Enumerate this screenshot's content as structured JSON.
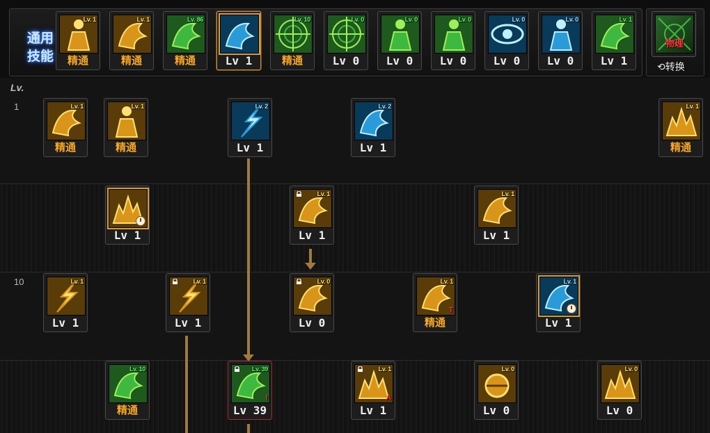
{
  "common_skills": {
    "title_line1": "通用",
    "title_line2": "技能",
    "items": [
      {
        "badge": "Lv. 1",
        "label": "精通",
        "mastery": true,
        "icon": "seated-figure-icon",
        "badge_color": "y"
      },
      {
        "badge": "Lv. 1",
        "label": "精通",
        "mastery": true,
        "icon": "arm-strength-icon",
        "badge_color": "y"
      },
      {
        "badge": "Lv. 86",
        "label": "精通",
        "mastery": true,
        "icon": "leg-kick-icon",
        "badge_color": "g"
      },
      {
        "badge": "",
        "label": "Lv 1",
        "mastery": false,
        "icon": "wings-burst-icon",
        "badge_color": "b"
      },
      {
        "badge": "Lv. 10",
        "label": "精通",
        "mastery": true,
        "icon": "crosshair-icon",
        "badge_color": "g"
      },
      {
        "badge": "Lv. 0",
        "label": "Lv 0",
        "mastery": false,
        "icon": "crosshair-icon",
        "badge_color": "g"
      },
      {
        "badge": "Lv. 0",
        "label": "Lv 0",
        "mastery": false,
        "icon": "silhouette-icon",
        "badge_color": "g"
      },
      {
        "badge": "Lv. 0",
        "label": "Lv 0",
        "mastery": false,
        "icon": "silhouette-icon",
        "badge_color": "g"
      },
      {
        "badge": "Lv. 0",
        "label": "Lv 0",
        "mastery": false,
        "icon": "eye-vision-icon",
        "badge_color": "b"
      },
      {
        "badge": "Lv. 0",
        "label": "Lv 0",
        "mastery": false,
        "icon": "body-figure-icon",
        "badge_color": "b"
      },
      {
        "badge": "Lv. 1",
        "label": "Lv 1",
        "mastery": false,
        "icon": "footstep-icon",
        "badge_color": "g"
      }
    ],
    "switch_icon_text": "物理",
    "switch_label": "转换"
  },
  "tree": {
    "header": "Lv.",
    "row_levels": [
      "1",
      "",
      "10",
      ""
    ],
    "skills": [
      {
        "badge": "Lv. 1",
        "label": "精通",
        "mastery": true,
        "icon": "muscle-arm-icon",
        "badge_color": "y",
        "lock": false,
        "clock": false,
        "mark": ""
      },
      {
        "badge": "Lv. 1",
        "label": "精通",
        "mastery": true,
        "icon": "strength-body-icon",
        "badge_color": "y",
        "lock": false,
        "clock": false,
        "mark": ""
      },
      {
        "badge": "Lv. 2",
        "label": "Lv 1",
        "mastery": false,
        "icon": "slash-kick-icon",
        "badge_color": "b",
        "lock": false,
        "clock": false,
        "mark": ""
      },
      {
        "badge": "Lv. 2",
        "label": "Lv 1",
        "mastery": false,
        "icon": "uppercut-icon",
        "badge_color": "b",
        "lock": false,
        "clock": false,
        "mark": ""
      },
      {
        "badge": "Lv. 1",
        "label": "精通",
        "mastery": true,
        "icon": "fire-burst-icon",
        "badge_color": "y",
        "lock": false,
        "clock": false,
        "mark": ""
      },
      {
        "badge": "",
        "label": "Lv 1",
        "mastery": false,
        "icon": "explosion-icon",
        "badge_color": "y",
        "lock": false,
        "clock": true,
        "mark": ""
      },
      {
        "badge": "Lv. 1",
        "label": "Lv 1",
        "mastery": false,
        "icon": "speed-dash-icon",
        "badge_color": "y",
        "lock": true,
        "clock": false,
        "mark": ""
      },
      {
        "badge": "Lv. 1",
        "label": "Lv 1",
        "mastery": false,
        "icon": "cannon-icon",
        "badge_color": "y",
        "lock": false,
        "clock": false,
        "mark": ""
      },
      {
        "badge": "Lv. 1",
        "label": "Lv 1",
        "mastery": false,
        "icon": "lightning-strike-icon",
        "badge_color": "y",
        "lock": false,
        "clock": false,
        "mark": ""
      },
      {
        "badge": "Lv. 1",
        "label": "Lv 1",
        "mastery": false,
        "icon": "claw-slash-icon",
        "badge_color": "y",
        "lock": true,
        "clock": false,
        "mark": ""
      },
      {
        "badge": "Lv. 0",
        "label": "Lv 0",
        "mastery": false,
        "icon": "ground-smash-icon",
        "badge_color": "y",
        "lock": true,
        "clock": false,
        "mark": ""
      },
      {
        "badge": "Lv. 1",
        "label": "精通",
        "mastery": true,
        "icon": "gauntlet-icon",
        "badge_color": "y",
        "lock": false,
        "clock": false,
        "mark": "T"
      },
      {
        "badge": "Lv. 1",
        "label": "Lv 1",
        "mastery": false,
        "icon": "tower-strike-icon",
        "badge_color": "b",
        "lock": false,
        "clock": true,
        "mark": ""
      },
      {
        "badge": "Lv. 10",
        "label": "精通",
        "mastery": true,
        "icon": "power-up-icon",
        "badge_color": "g",
        "lock": false,
        "clock": false,
        "mark": ""
      },
      {
        "badge": "Lv. 39",
        "label": "Lv 39",
        "mastery": false,
        "icon": "awakening-icon",
        "badge_color": "g",
        "lock": true,
        "clock": false,
        "mark": "!"
      },
      {
        "badge": "Lv. 1",
        "label": "Lv 1",
        "mastery": false,
        "icon": "flame-pillar-icon",
        "badge_color": "y",
        "lock": true,
        "clock": false,
        "mark": "A"
      },
      {
        "badge": "Lv. 0",
        "label": "Lv 0",
        "mastery": false,
        "icon": "orb-bomb-icon",
        "badge_color": "y",
        "lock": false,
        "clock": false,
        "mark": ""
      },
      {
        "badge": "Lv. 0",
        "label": "Lv 0",
        "mastery": false,
        "icon": "flame-wave-icon",
        "badge_color": "y",
        "lock": false,
        "clock": false,
        "mark": ""
      }
    ]
  },
  "colors": {
    "mastery_text": "#f7a723",
    "connector": "#a07a40",
    "selected_border": "#c69040",
    "title_glow": "#3a8cff"
  }
}
